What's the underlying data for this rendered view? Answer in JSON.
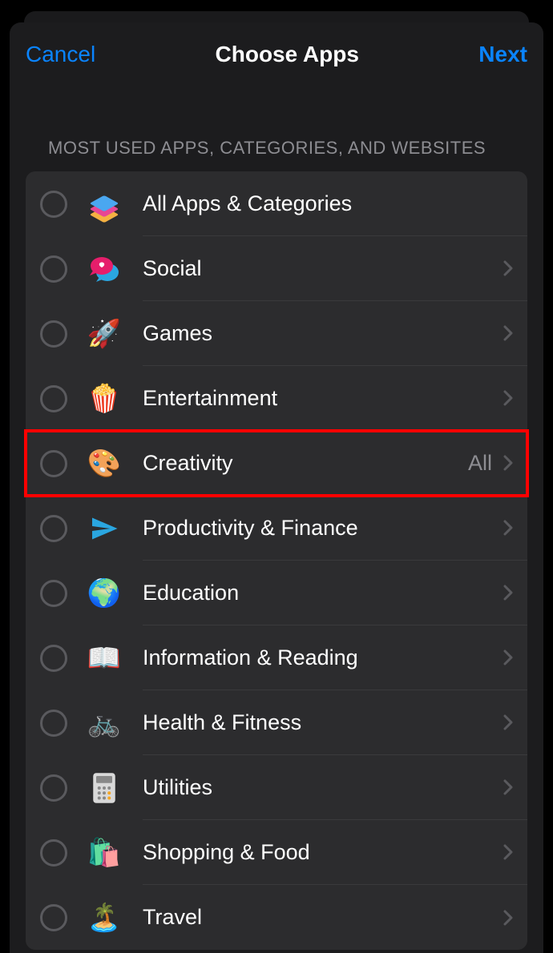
{
  "navbar": {
    "cancel": "Cancel",
    "title": "Choose Apps",
    "next": "Next"
  },
  "section_header": "MOST USED APPS, CATEGORIES, AND WEBSITES",
  "categories": [
    {
      "id": "all",
      "label": "All Apps & Categories",
      "icon": "stack",
      "detail": "",
      "chevron": false,
      "highlighted": false
    },
    {
      "id": "social",
      "label": "Social",
      "icon": "💬",
      "detail": "",
      "chevron": true,
      "highlighted": false
    },
    {
      "id": "games",
      "label": "Games",
      "icon": "🚀",
      "detail": "",
      "chevron": true,
      "highlighted": false
    },
    {
      "id": "entertainment",
      "label": "Entertainment",
      "icon": "🍿",
      "detail": "",
      "chevron": true,
      "highlighted": false
    },
    {
      "id": "creativity",
      "label": "Creativity",
      "icon": "🎨",
      "detail": "All",
      "chevron": true,
      "highlighted": true
    },
    {
      "id": "productivity",
      "label": "Productivity & Finance",
      "icon": "paperplane",
      "detail": "",
      "chevron": true,
      "highlighted": false
    },
    {
      "id": "education",
      "label": "Education",
      "icon": "🌍",
      "detail": "",
      "chevron": true,
      "highlighted": false
    },
    {
      "id": "information",
      "label": "Information & Reading",
      "icon": "📖",
      "detail": "",
      "chevron": true,
      "highlighted": false
    },
    {
      "id": "health",
      "label": "Health & Fitness",
      "icon": "🚲",
      "detail": "",
      "chevron": true,
      "highlighted": false
    },
    {
      "id": "utilities",
      "label": "Utilities",
      "icon": "calculator",
      "detail": "",
      "chevron": true,
      "highlighted": false
    },
    {
      "id": "shopping",
      "label": "Shopping & Food",
      "icon": "🛍️",
      "detail": "",
      "chevron": true,
      "highlighted": false
    },
    {
      "id": "travel",
      "label": "Travel",
      "icon": "🏝️",
      "detail": "",
      "chevron": true,
      "highlighted": false
    }
  ]
}
